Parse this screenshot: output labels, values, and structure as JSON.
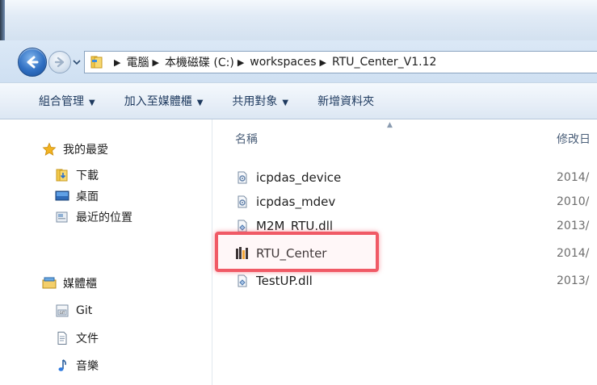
{
  "address": {
    "crumbs": [
      "電腦",
      "本機磁碟 (C:)",
      "workspaces",
      "RTU_Center_V1.12"
    ]
  },
  "toolbar": {
    "organize": "組合管理",
    "include_library": "加入至媒體櫃",
    "share_with": "共用對象",
    "new_folder": "新增資料夾"
  },
  "nav": {
    "favorites": "我的最愛",
    "downloads": "下載",
    "desktop": "桌面",
    "recent": "最近的位置",
    "libraries": "媒體櫃",
    "git": "Git",
    "documents": "文件",
    "music": "音樂"
  },
  "columns": {
    "name": "名稱",
    "modified": "修改日"
  },
  "files": [
    {
      "name": "icpdas_device",
      "date": "2014/",
      "icon": "config-file-icon"
    },
    {
      "name": "icpdas_mdev",
      "date": "2010/",
      "icon": "config-file-icon"
    },
    {
      "name": "M2M_RTU.dll",
      "date": "2013/",
      "icon": "dll-file-icon"
    },
    {
      "name": "RTU_Center",
      "date": "2014/",
      "icon": "app-exe-icon"
    },
    {
      "name": "TestUP.dll",
      "date": "2013/",
      "icon": "dll-file-icon"
    }
  ],
  "colors": {
    "highlight_border": "#f05a66",
    "toolbar_text": "#1e3a5f",
    "star": "#f2b322"
  }
}
